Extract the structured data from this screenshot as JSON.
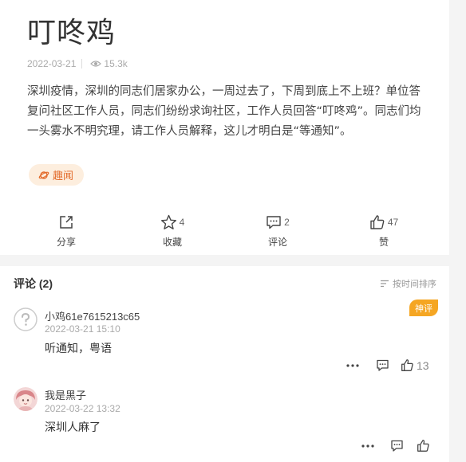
{
  "article": {
    "title": "叮咚鸡",
    "date": "2022-03-21",
    "views": "15.3k",
    "body": "深圳疫情，深圳的同志们居家办公，一周过去了，下周到底上不上班？单位答复问社区工作人员，同志们纷纷求询社区，工作人员回答“叮咚鸡”。同志们均一头雾水不明究理，请工作人员解释，这儿才明白是“等通知”。",
    "tag": "趣闻",
    "actions": {
      "share_label": "分享",
      "favorite_count": "4",
      "favorite_label": "收藏",
      "comment_count": "2",
      "comment_label": "评论",
      "like_count": "47",
      "like_label": "赞"
    }
  },
  "comments": {
    "header": "评论 (2)",
    "sort_label": "按时间排序",
    "items": [
      {
        "user": "小鸡61e7615213c65",
        "time": "2022-03-21 15:10",
        "text": "听通知，粤语",
        "badge": "神评",
        "likes": "13"
      },
      {
        "user": "我是黑子",
        "time": "2022-03-22 13:32",
        "text": "深圳人麻了"
      }
    ]
  },
  "colors": {
    "tag_bg": "#fdeede",
    "tag_text": "#e36b2b",
    "badge": "#f5a623"
  }
}
